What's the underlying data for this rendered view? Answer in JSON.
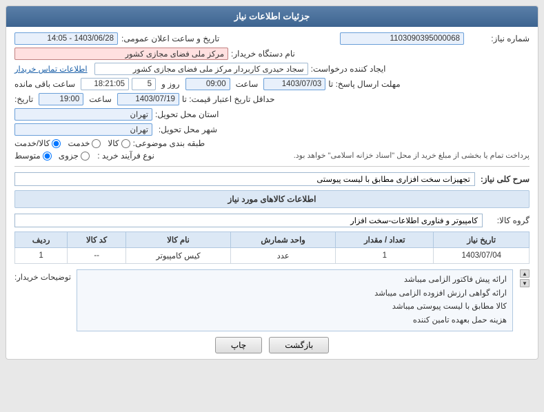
{
  "header": {
    "title": "جزئیات اطلاعات نیاز"
  },
  "fields": {
    "shomareNiaz_label": "شماره نیاز:",
    "shomareNiaz_value": "1103090395000068",
    "namDastgah_label": "نام دستگاه خریدار:",
    "namDastgah_value": "مرکز ملی فضای مجازی کشور",
    "ijadKonande_label": "ایجاد کننده درخواست:",
    "ijadKonande_value": "سجاد حیدری کاربردار مرکز ملی فضای مجازی کشور",
    "ijadKonande_link": "اطلاعات تماس خریدار",
    "mohlatErsalLabel": "مهلت ارسال پاسخ: تا",
    "mohlatErsalDate": "1403/07/03",
    "mohlatErsalTime": "09:00",
    "mohlatErsalRooz": "5",
    "mohlatErsalSaat": "18:21:05",
    "mohlatErsalBaqi": "ساعت باقی مانده",
    "hadaqalTarikh_label": "حداقل تاریخ اعتبار قیمت: تا",
    "hadaqalDate": "1403/07/19",
    "hadaqalTime": "19:00",
    "tarikhLabel": "تاریخ:",
    "tarikhVaSaat_label": "تاریخ و ساعت اعلان عمومی:",
    "tarikhVaSaat_value": "1403/06/28 - 14:05",
    "ostan_label": "استان محل تحویل:",
    "ostan_value": "تهران",
    "shahr_label": "شهر محل تحویل:",
    "shahr_value": "تهران",
    "tabaqe_label": "طبقه بندی موضوعی:",
    "tabaqe_kala": "کالا",
    "tabaqe_khadamat": "خدمت",
    "tabaqe_kala_khadamat": "کالا/خدمت",
    "nawNiaz_label": "نوع فرآیند خرید :",
    "nawNiaz_jozvi": "جزوی",
    "nawNiaz_motovasset": "متوسط",
    "nawNiaz_note": "پرداخت تمام یا بخشی از مبلغ خرید از محل \"اسناد خزانه اسلامی\" خواهد بود.",
    "sarkenli_label": "سرح کلی نیاز:",
    "sarkenli_value": "تجهیزات سخت افزاری مطابق با لیست پیوستی",
    "section_title": "اطلاعات کالاهای مورد نیاز",
    "groupKala_label": "گروه کالا:",
    "groupKala_value": "کامپیوتر و فناوری اطلاعات-سخت افزار",
    "table": {
      "headers": [
        "ردیف",
        "کد کالا",
        "نام کالا",
        "واحد شمارش",
        "تعداد / مقدار",
        "تاریخ نیاز"
      ],
      "rows": [
        {
          "radif": "1",
          "kodKala": "--",
          "namKala": "کیس کامپیوتر",
          "vahed": "عدد",
          "tedad": "1",
          "tarikh": "1403/07/04"
        }
      ]
    },
    "tawzih_label": "توضیحات خریدار:",
    "tawzih_lines": [
      "ارائه پیش فاکتور الزامی میباشد",
      "ارائه گواهی ارزش افزوده الزامی میباشد",
      "کالا مطابق با لیست پیوستی میباشد",
      "هزینه حمل بعهده تامین کننده"
    ]
  },
  "buttons": {
    "chap_label": "چاپ",
    "bazgasht_label": "بازگشت"
  }
}
